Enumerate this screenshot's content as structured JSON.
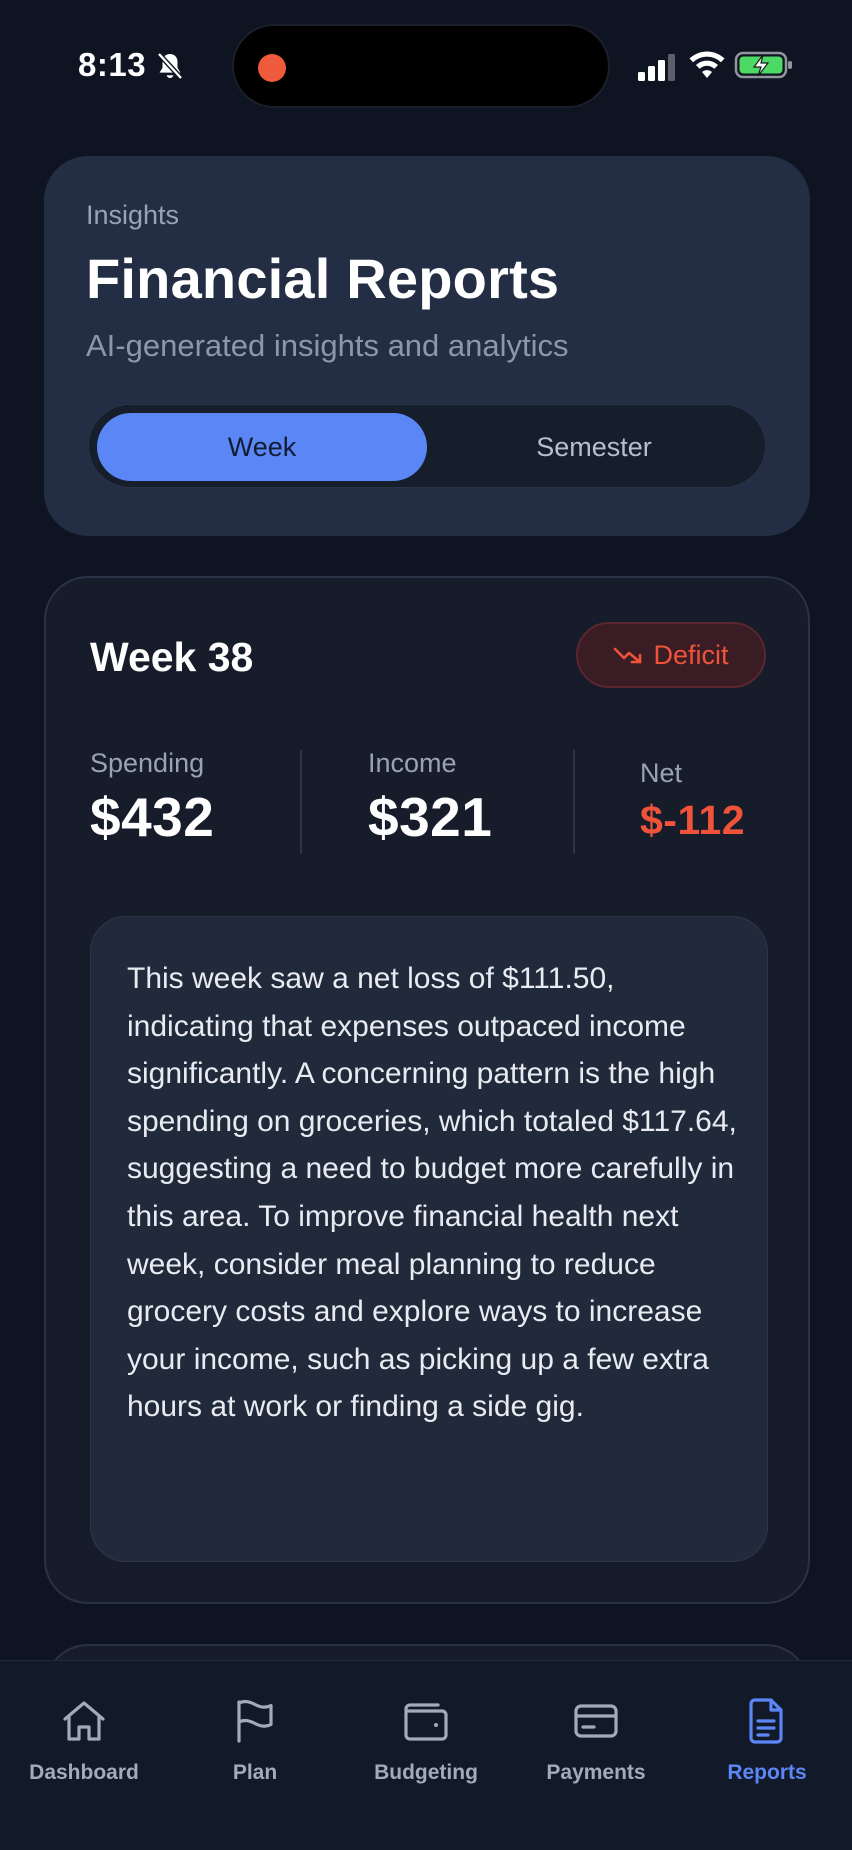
{
  "status_bar": {
    "time": "8:13"
  },
  "header": {
    "eyebrow": "Insights",
    "title": "Financial Reports",
    "subtitle": "AI-generated insights and analytics",
    "segments": {
      "week": "Week",
      "semester": "Semester",
      "selected": "Week"
    }
  },
  "report": {
    "title": "Week 38",
    "badge": "Deficit",
    "stats": {
      "spending": {
        "label": "Spending",
        "value": "$432"
      },
      "income": {
        "label": "Income",
        "value": "$321"
      },
      "net": {
        "label": "Net",
        "value": "$-112"
      }
    },
    "insight": "This week saw a net loss of $111.50, indicating that expenses outpaced income significantly. A concerning pattern is the high spending on groceries, which totaled $117.64, suggesting a need to budget more carefully in this area. To improve financial health next week, consider meal planning to reduce grocery costs and explore ways to increase your income, such as picking up a few extra hours at work or finding a side gig."
  },
  "tabs": [
    {
      "label": "Dashboard",
      "icon": "home-icon"
    },
    {
      "label": "Plan",
      "icon": "flag-icon"
    },
    {
      "label": "Budgeting",
      "icon": "wallet-icon"
    },
    {
      "label": "Payments",
      "icon": "card-icon"
    },
    {
      "label": "Reports",
      "icon": "document-icon",
      "active": true
    }
  ],
  "colors": {
    "accent": "#5b86f5",
    "deficit": "#f0533a",
    "background": "#0f1422",
    "card": "#232d43"
  }
}
